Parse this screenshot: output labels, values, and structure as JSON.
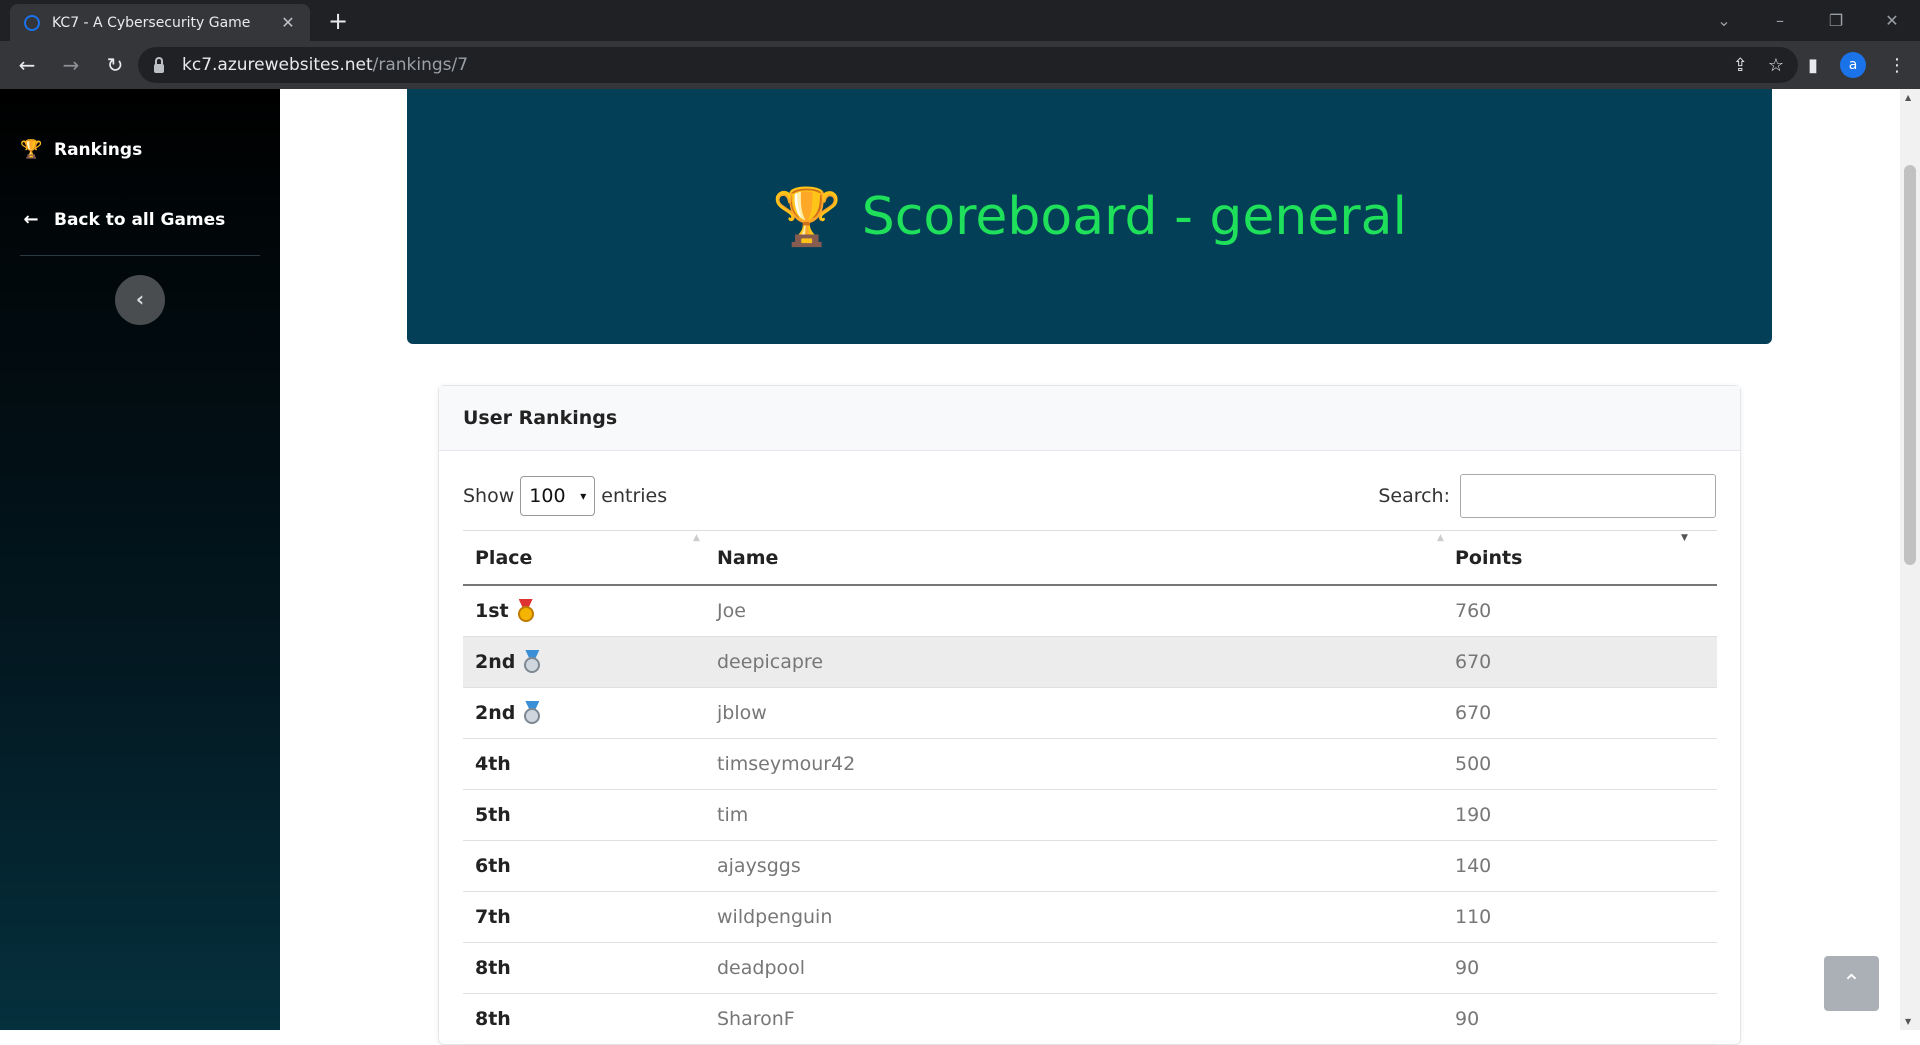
{
  "browser": {
    "tab_title": "KC7 - A Cybersecurity Game",
    "url_host": "kc7.azurewebsites.net",
    "url_path": "/rankings/7",
    "profile_initial": "a"
  },
  "sidebar": {
    "items": [
      {
        "label": "Rankings",
        "icon": "trophy-icon"
      },
      {
        "label": "Back to all Games",
        "icon": "arrow-left-icon"
      }
    ],
    "collapse_label": "‹"
  },
  "hero": {
    "title": "Scoreboard - general"
  },
  "rankings": {
    "card_title": "User Rankings",
    "show_label": "Show",
    "entries_value": "100",
    "entries_label": "entries",
    "search_label": "Search:",
    "search_value": "",
    "columns": [
      "Place",
      "Name",
      "Points"
    ],
    "rows": [
      {
        "place": "1st",
        "medal": "gold",
        "name": "Joe",
        "points": "760"
      },
      {
        "place": "2nd",
        "medal": "silver",
        "name": "deepicapre",
        "points": "670"
      },
      {
        "place": "2nd",
        "medal": "silver",
        "name": "jblow",
        "points": "670"
      },
      {
        "place": "4th",
        "medal": "",
        "name": "timseymour42",
        "points": "500"
      },
      {
        "place": "5th",
        "medal": "",
        "name": "tim",
        "points": "190"
      },
      {
        "place": "6th",
        "medal": "",
        "name": "ajaysggs",
        "points": "140"
      },
      {
        "place": "7th",
        "medal": "",
        "name": "wildpenguin",
        "points": "110"
      },
      {
        "place": "8th",
        "medal": "",
        "name": "deadpool",
        "points": "90"
      },
      {
        "place": "8th",
        "medal": "",
        "name": "SharonF",
        "points": "90"
      }
    ]
  },
  "colors": {
    "hero_bg": "#033f56",
    "hero_text": "#1fe05a",
    "sidebar_bg": "#000000"
  }
}
